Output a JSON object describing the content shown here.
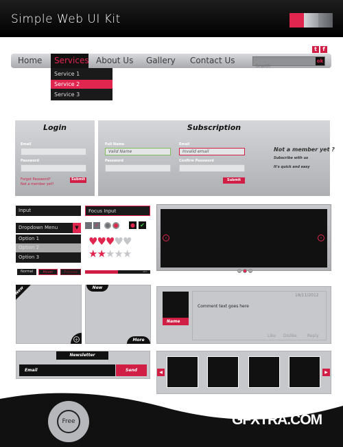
{
  "header": {
    "title": "Simple Web UI Kit",
    "swatches": [
      "#e0254f",
      "#b9bcc1",
      "#6d7076"
    ]
  },
  "nav": {
    "items": [
      "Home",
      "Services",
      "About Us",
      "Gallery",
      "Contact Us"
    ],
    "active": "Services",
    "search_placeholder": "Search",
    "search_button": "ok",
    "social": [
      "t",
      "f"
    ],
    "dropdown": [
      "Service 1",
      "Service 2",
      "Service 3"
    ],
    "dropdown_active": "Service 2"
  },
  "login": {
    "title": "Login",
    "email_label": "Email",
    "password_label": "Password",
    "forgot": "Forgot Password?",
    "not_member": "Not a member yet?",
    "submit": "Submit"
  },
  "subscription": {
    "title": "Subscription",
    "fullname_label": "Full Name",
    "fullname_value": "Valid Name",
    "email_label": "Email",
    "email_value": "Invalid email",
    "password_label": "Password",
    "confirm_label": "Confirm Password",
    "submit": "Submit",
    "side_heading": "Not a member yet ?",
    "side_line1": "Subscribe with us",
    "side_line2": "It's quick and easy"
  },
  "controls": {
    "input": "Input",
    "focus_input": "Focus Input",
    "dropdown_label": "Dropdown Menu",
    "options": [
      "Option 1",
      "Option 2",
      "Option 3"
    ],
    "option_selected": "Option 2",
    "buttons": [
      "Normal",
      "Hover",
      "Pressed"
    ],
    "hearts_rating": 3,
    "hearts_total": 5,
    "stars_rating": 2,
    "stars_total": 5,
    "progress_percent": 50,
    "progress_label": "46%"
  },
  "slider": {
    "dots": 3,
    "active_dot": 2
  },
  "cards": {
    "new_label": "New",
    "more_label": "More"
  },
  "comment": {
    "date": "18/11/2012",
    "text": "Comment text goes here",
    "name": "Name",
    "actions": [
      "Like",
      "Dislike",
      "Reply"
    ]
  },
  "newsletter": {
    "title": "Newsletter",
    "email_placeholder": "Email",
    "send": "Send"
  },
  "footer": {
    "badge": "Free",
    "watermark": "GFXTRA.COM"
  }
}
